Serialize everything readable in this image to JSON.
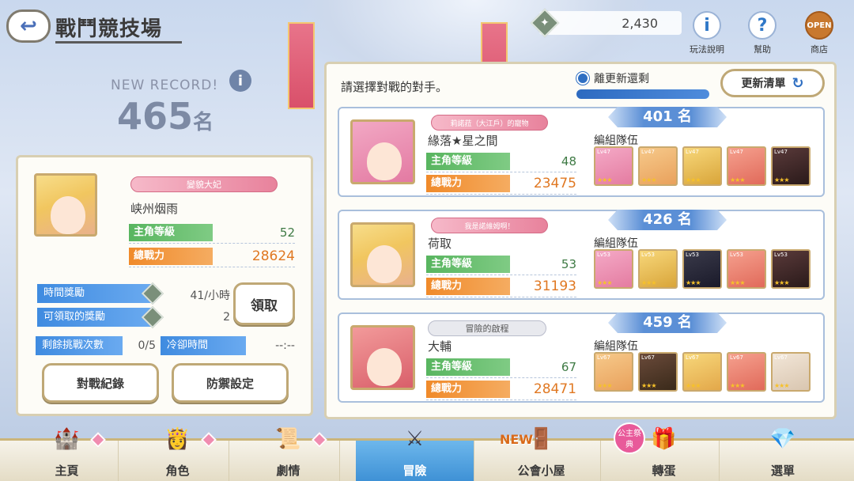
{
  "header": {
    "back_symbol": "↩",
    "title": "戰鬥競技場",
    "currency_value": "2,430",
    "icons": [
      {
        "name": "help",
        "label": "玩法說明",
        "glyph": "i"
      },
      {
        "name": "assist",
        "label": "幫助",
        "glyph": "?"
      },
      {
        "name": "shop",
        "label": "商店",
        "glyph": "OPEN"
      }
    ]
  },
  "record": {
    "new_record": "NEW RECORD!",
    "rank": "465",
    "rank_suffix": "名"
  },
  "player": {
    "title_tag": "變貌大妃",
    "name": "峡州烟雨",
    "level_label": "主角等級",
    "level": "52",
    "power_label": "總戰力",
    "power": "28624"
  },
  "rewards": {
    "time_label": "時間獎勵",
    "time_value": "41/小時",
    "claimable_label": "可領取的獎勵",
    "claimable_value": "2",
    "claim_button": "領取",
    "remaining_label": "剩餘挑戰次數",
    "remaining_value": "0/5",
    "cooldown_label": "冷卻時間",
    "cooldown_value": "--:--"
  },
  "buttons": {
    "history": "對戰紀錄",
    "defense": "防禦設定"
  },
  "opponents_panel": {
    "prompt": "請選擇對戰的對手。",
    "refresh_timer_label": "離更新還剩",
    "refresh_button": "更新清單",
    "refresh_progress": 1.0
  },
  "opponents": [
    {
      "rank": "401 名",
      "title_tag": "莉諾菈（大江戶）的寵物",
      "name": "緣落★星之間",
      "level_label": "主角等級",
      "level": "48",
      "power_label": "總戰力",
      "power": "23475",
      "team_label": "編組隊伍",
      "team_levels": [
        "Lv47",
        "Lv47",
        "Lv47",
        "Lv47",
        "Lv47"
      ]
    },
    {
      "rank": "426 名",
      "title_tag": "我是諾維姆啊！",
      "name": "荷取",
      "level_label": "主角等級",
      "level": "53",
      "power_label": "總戰力",
      "power": "31193",
      "team_label": "編組隊伍",
      "team_levels": [
        "Lv53",
        "Lv53",
        "Lv53",
        "Lv53",
        "Lv53"
      ]
    },
    {
      "rank": "459 名",
      "title_tag": "冒險的啟程",
      "name": "大輔",
      "level_label": "主角等級",
      "level": "67",
      "power_label": "總戰力",
      "power": "28471",
      "team_label": "編組隊伍",
      "team_levels": [
        "Lv67",
        "Lv67",
        "Lv67",
        "Lv67",
        "Lv67"
      ]
    }
  ],
  "nav": {
    "items": [
      {
        "label": "主頁",
        "icon": "castle-icon"
      },
      {
        "label": "角色",
        "icon": "character-icon"
      },
      {
        "label": "劇情",
        "icon": "scroll-icon"
      },
      {
        "label": "冒險",
        "icon": "swords-icon"
      },
      {
        "label": "公會小屋",
        "icon": "door-icon"
      },
      {
        "label": "轉蛋",
        "icon": "gacha-icon"
      },
      {
        "label": "選單",
        "icon": "crystal-icon"
      }
    ],
    "new_badge": "NEW",
    "gacha_badge": "公主祭典"
  },
  "colors": {
    "accent_blue": "#3c8fd4",
    "level_green": "#58b55f",
    "power_orange": "#f08a2a"
  }
}
